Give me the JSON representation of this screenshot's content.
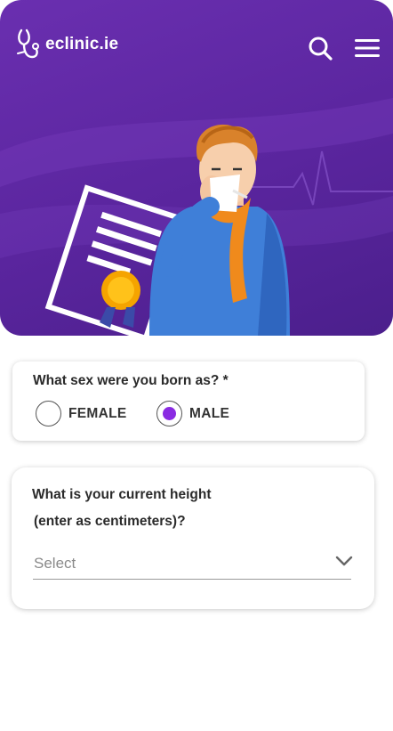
{
  "header": {
    "logo_text": "eclinic.ie",
    "search_icon": "search-icon",
    "menu_icon": "hamburger-menu-icon"
  },
  "hero": {
    "illustration": "sick-man-with-tissue-and-certificate",
    "background_color": "#5a259e"
  },
  "sex_question": {
    "label": "What sex were you born as? *",
    "options": [
      {
        "label": "FEMALE",
        "selected": false
      },
      {
        "label": "MALE",
        "selected": true
      }
    ],
    "accent_color": "#8a2be2"
  },
  "height_question": {
    "label_line1": "What is your current height",
    "label_line2": "(enter as centimeters)?",
    "select_value": "Select",
    "chevron_icon": "chevron-down-icon"
  }
}
